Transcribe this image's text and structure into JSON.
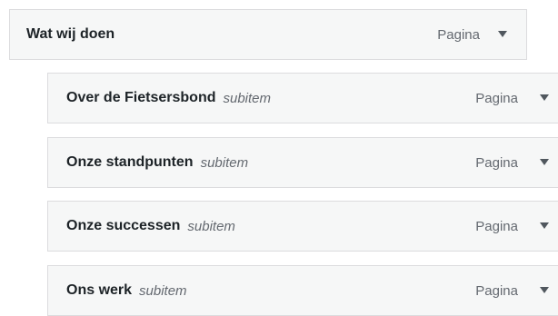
{
  "menu": {
    "top_item": {
      "title": "Wat wij doen",
      "type": "Pagina",
      "toggle_icon": "triangle-down-icon"
    },
    "sub_items": [
      {
        "title": "Over de Fietsersbond",
        "subtitle": "subitem",
        "type": "Pagina",
        "toggle_icon": "triangle-down-icon"
      },
      {
        "title": "Onze standpunten",
        "subtitle": "subitem",
        "type": "Pagina",
        "toggle_icon": "triangle-down-icon"
      },
      {
        "title": "Onze successen",
        "subtitle": "subitem",
        "type": "Pagina",
        "toggle_icon": "triangle-down-icon"
      },
      {
        "title": "Ons werk",
        "subtitle": "subitem",
        "type": "Pagina",
        "toggle_icon": "triangle-down-icon"
      }
    ]
  },
  "colors": {
    "item_background": "#f6f7f7",
    "item_border": "#dcdcde",
    "title_text": "#1d2327",
    "muted_text": "#646970"
  }
}
